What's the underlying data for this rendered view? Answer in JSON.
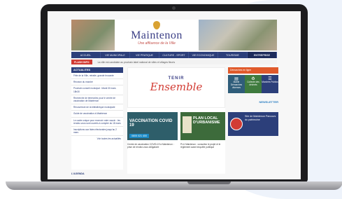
{
  "site": {
    "title": "Maintenon",
    "tagline": "Une affluence de la Ville"
  },
  "nav": {
    "items": [
      "ACCUEIL",
      "VIE MUNICIPALE",
      "VIE PRATIQUE",
      "CULTURE - SPORT",
      "VIE ECONOMIQUE",
      "TOURISME",
      "ENTREPRISE"
    ]
  },
  "alert": {
    "button_label": "FLASH INFO",
    "text": "La ville est candidate au prochain label national de villes et villages fleuris"
  },
  "sidebar": {
    "heading": "ACTUALITES",
    "news": [
      "Fête de la Ville, retraite, grande brocante",
      "Réunion du marché",
      "Prochain conseil municipal : Mardi 30 mars 18h30",
      "Recherche de bénévoles pour le centre de vaccination de Maintenon",
      "Réouverture de la bibliothèque municipale",
      "Guide de vaccination à Maintenon",
      "Le cadre unique pour recevoir votre vaccin : les rendez-vous sont ouverts à compter du 18 mars",
      "Inscriptions aux listes électorales jusqu'au 2 mars"
    ],
    "footer_link": "Voir toutes les actualités",
    "agenda_label": "L'AGENDA"
  },
  "main": {
    "hero_top": "TENIR",
    "hero_script": "Ensemble",
    "vacc_title": "VACCINATION COVID 19",
    "vacc_phone": "0805 021 400",
    "plu_title": "PLAN LOCAL D'URBANISME",
    "caption_left": "Centre de vaccination COVID-19 à Maintenon : prise de rendez-vous obligatoire",
    "caption_right": "PLU Maintenon : consultez le projet et le règlement avant enquête publique"
  },
  "right": {
    "quick_heading": "Démarches en ligne",
    "quick": [
      {
        "icon": "▤",
        "label": "Mairie Démarches diverses"
      },
      {
        "icon": "♻",
        "label": "Collecte des déchets"
      },
      {
        "icon": "☰",
        "label": "Marchés Publics"
      }
    ],
    "newsletter": "NEWSLETTER",
    "promo_text": "Site de Maintenon Parcours du patrimoine"
  }
}
